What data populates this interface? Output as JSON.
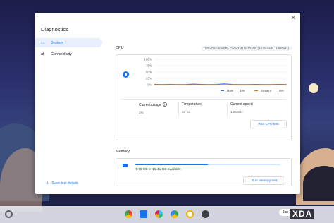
{
  "app": {
    "title": "Diagnostics",
    "close_glyph": "✕"
  },
  "sidebar": {
    "items": [
      {
        "label": "System",
        "icon": "laptop-icon",
        "active": true
      },
      {
        "label": "Connectivity",
        "icon": "arrows-icon",
        "active": false
      }
    ],
    "save_label": "Save test details"
  },
  "cpu": {
    "section_title": "CPU",
    "model": "12th Gen Intel(R) Core(TM) i5-1240P (16 threads, 3.89GHz)",
    "y_ticks": [
      "100%",
      "75%",
      "50%",
      "25%",
      "0%"
    ],
    "legend": {
      "user_label": "User",
      "user_value": "1%",
      "system_label": "System",
      "system_value": "0%"
    },
    "stats": {
      "usage_label": "Current usage",
      "usage_value": "1%",
      "temp_label": "Temperature",
      "temp_value": "33° C",
      "speed_label": "Current speed",
      "speed_value": "1.06GHz"
    },
    "run_label": "Run CPU test"
  },
  "chart_data": {
    "type": "line",
    "title": "",
    "xlabel": "",
    "ylabel": "",
    "ylim": [
      0,
      100
    ],
    "y_ticks": [
      "100%",
      "75%",
      "50%",
      "25%",
      "0%"
    ],
    "series": [
      {
        "name": "User",
        "values": [
          2,
          1,
          2,
          1,
          1,
          3,
          2,
          1,
          2,
          4,
          2,
          1,
          1,
          2,
          1,
          1,
          2,
          1
        ]
      },
      {
        "name": "System",
        "values": [
          0,
          0,
          1,
          0,
          0,
          1,
          0,
          0,
          0,
          1,
          0,
          0,
          0,
          0,
          0,
          0,
          1,
          0
        ]
      }
    ],
    "legend_position": "bottom-right",
    "grid": true
  },
  "memory": {
    "section_title": "Memory",
    "available_text": "7.76 GB of 15.41 GB available",
    "fill_fraction": 0.5,
    "run_label": "Run Memory test"
  },
  "shelf": {
    "date_text": "Jan 20",
    "watermark": "XDA"
  },
  "colors": {
    "accent": "#1a73e8",
    "user_series": "#1a73e8",
    "system_series": "#e8710a",
    "nav_active_bg": "#e8f0fe"
  }
}
